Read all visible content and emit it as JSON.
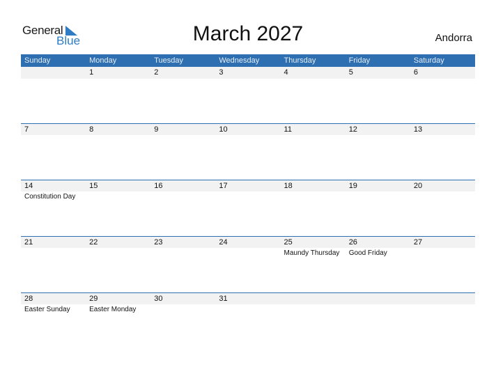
{
  "logo": {
    "general": "General",
    "blue": "Blue"
  },
  "title": "March 2027",
  "country": "Andorra",
  "weekdays": [
    "Sunday",
    "Monday",
    "Tuesday",
    "Wednesday",
    "Thursday",
    "Friday",
    "Saturday"
  ],
  "weeks": [
    [
      {
        "day": "",
        "holiday": ""
      },
      {
        "day": "1",
        "holiday": ""
      },
      {
        "day": "2",
        "holiday": ""
      },
      {
        "day": "3",
        "holiday": ""
      },
      {
        "day": "4",
        "holiday": ""
      },
      {
        "day": "5",
        "holiday": ""
      },
      {
        "day": "6",
        "holiday": ""
      }
    ],
    [
      {
        "day": "7",
        "holiday": ""
      },
      {
        "day": "8",
        "holiday": ""
      },
      {
        "day": "9",
        "holiday": ""
      },
      {
        "day": "10",
        "holiday": ""
      },
      {
        "day": "11",
        "holiday": ""
      },
      {
        "day": "12",
        "holiday": ""
      },
      {
        "day": "13",
        "holiday": ""
      }
    ],
    [
      {
        "day": "14",
        "holiday": "Constitution Day"
      },
      {
        "day": "15",
        "holiday": ""
      },
      {
        "day": "16",
        "holiday": ""
      },
      {
        "day": "17",
        "holiday": ""
      },
      {
        "day": "18",
        "holiday": ""
      },
      {
        "day": "19",
        "holiday": ""
      },
      {
        "day": "20",
        "holiday": ""
      }
    ],
    [
      {
        "day": "21",
        "holiday": ""
      },
      {
        "day": "22",
        "holiday": ""
      },
      {
        "day": "23",
        "holiday": ""
      },
      {
        "day": "24",
        "holiday": ""
      },
      {
        "day": "25",
        "holiday": "Maundy Thursday"
      },
      {
        "day": "26",
        "holiday": "Good Friday"
      },
      {
        "day": "27",
        "holiday": ""
      }
    ],
    [
      {
        "day": "28",
        "holiday": "Easter Sunday"
      },
      {
        "day": "29",
        "holiday": "Easter Monday"
      },
      {
        "day": "30",
        "holiday": ""
      },
      {
        "day": "31",
        "holiday": ""
      },
      {
        "day": "",
        "holiday": ""
      },
      {
        "day": "",
        "holiday": ""
      },
      {
        "day": "",
        "holiday": ""
      }
    ]
  ],
  "colors": {
    "header": "#2d6fb1",
    "brand_blue": "#2e7cc4",
    "date_row": "#f2f2f2"
  }
}
